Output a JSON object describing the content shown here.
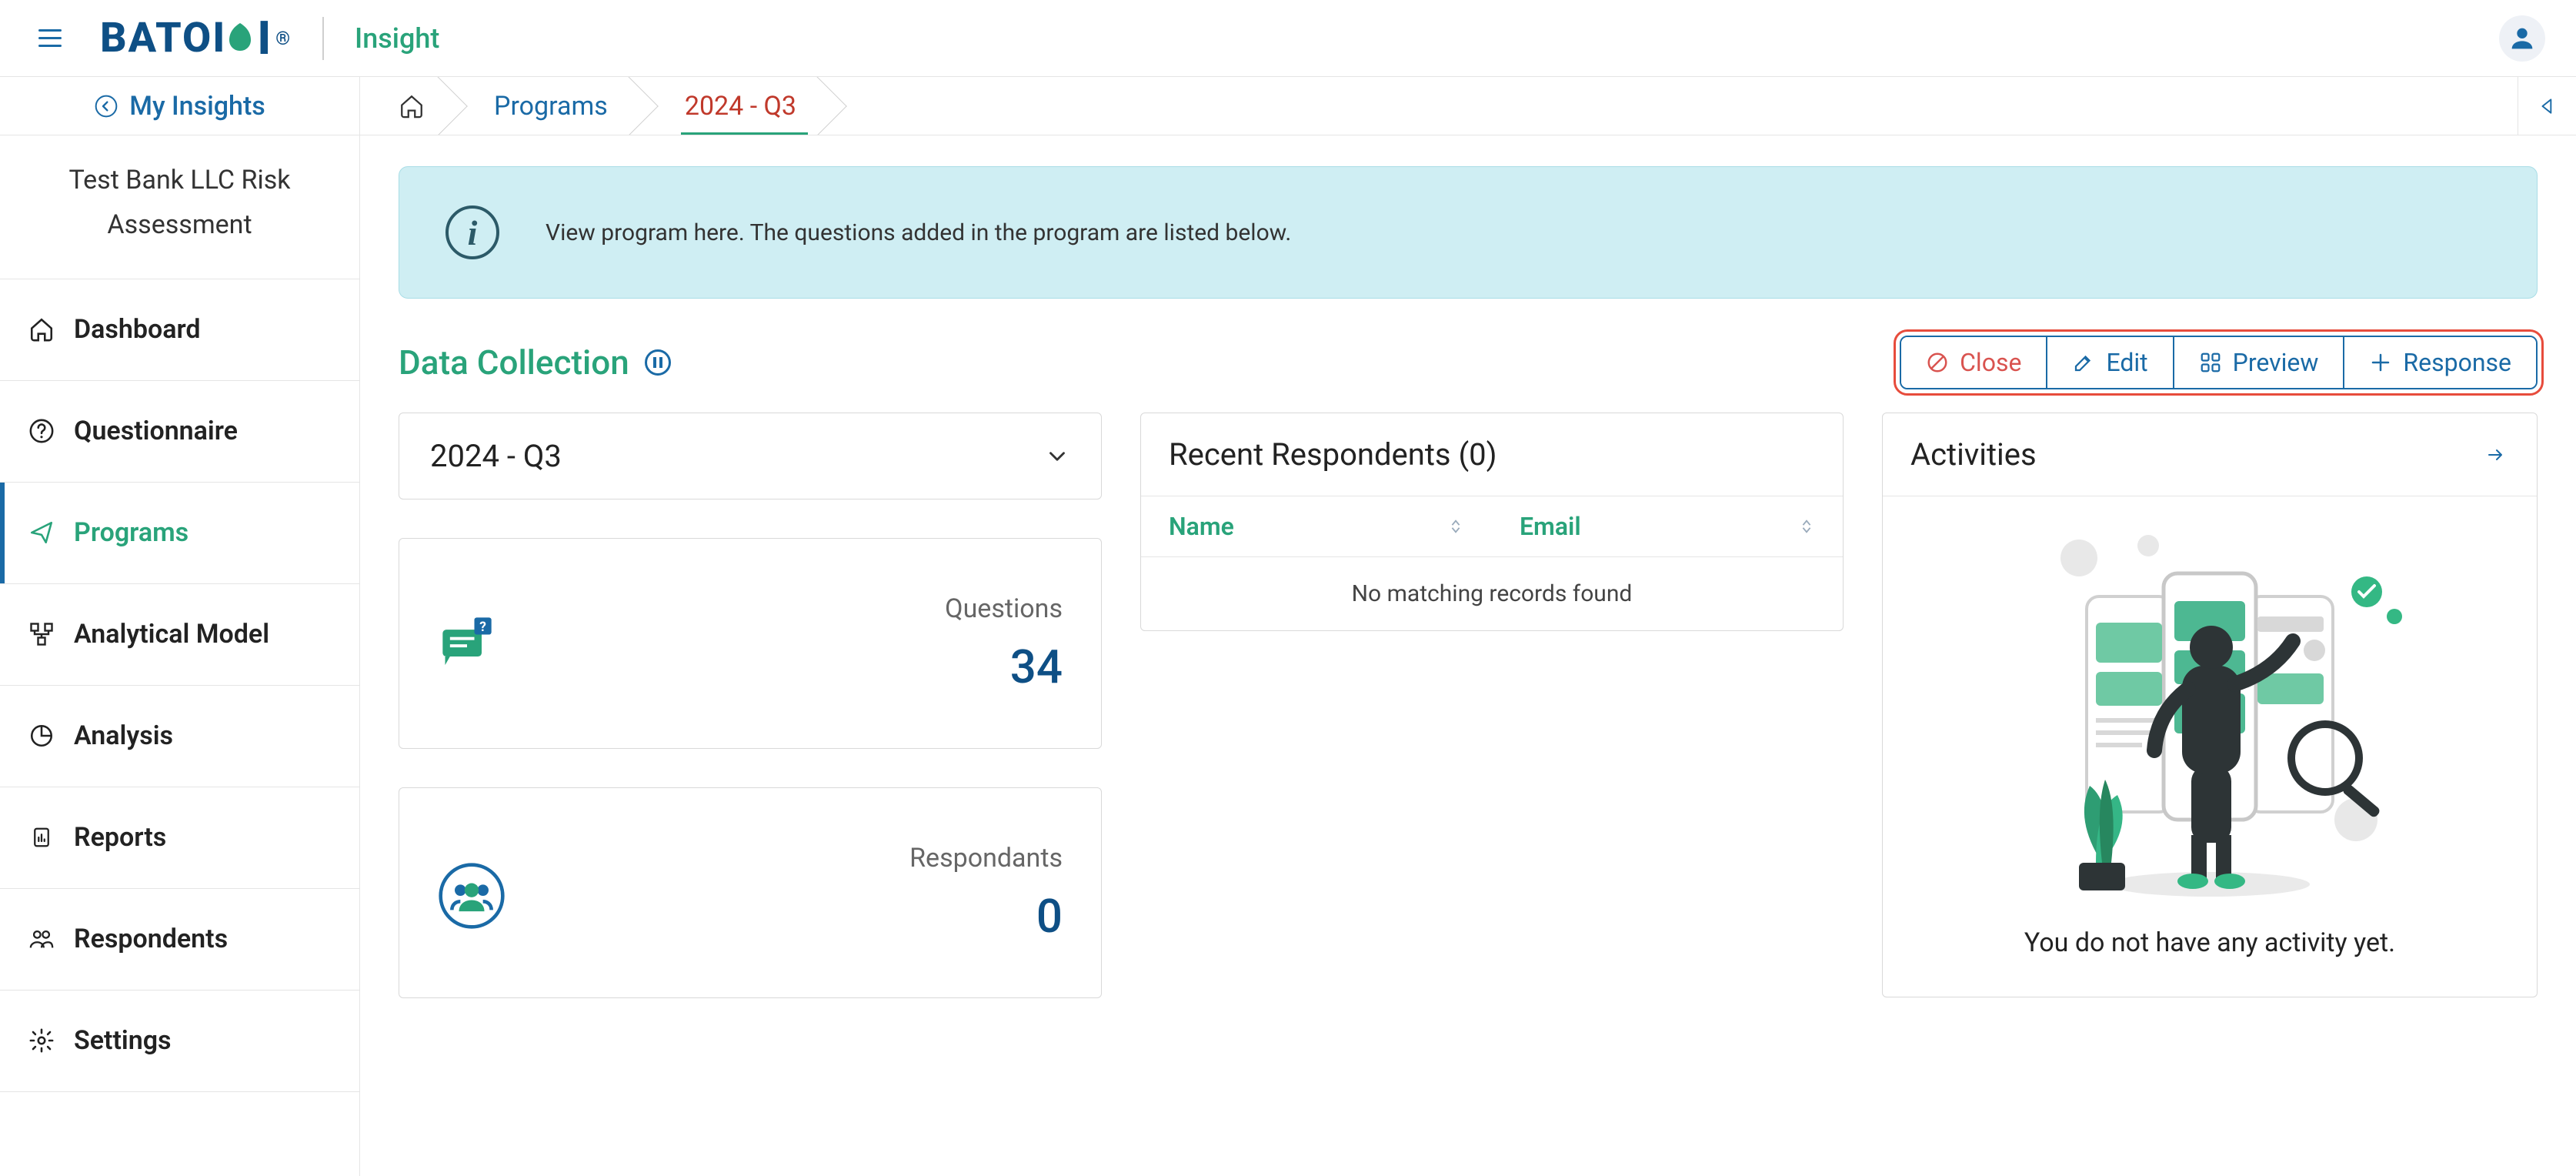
{
  "header": {
    "brand": "BATOI",
    "product": "Insight",
    "my_insights_label": "My Insights"
  },
  "breadcrumb": {
    "programs_label": "Programs",
    "current_label": "2024  -  Q3"
  },
  "sidebar": {
    "title": "Test Bank LLC Risk Assessment",
    "items": [
      {
        "label": "Dashboard",
        "icon": "home-icon"
      },
      {
        "label": "Questionnaire",
        "icon": "question-icon"
      },
      {
        "label": "Programs",
        "icon": "send-icon",
        "active": true
      },
      {
        "label": "Analytical Model",
        "icon": "model-icon"
      },
      {
        "label": "Analysis",
        "icon": "pie-icon"
      },
      {
        "label": "Reports",
        "icon": "report-icon"
      },
      {
        "label": "Respondents",
        "icon": "people-icon"
      },
      {
        "label": "Settings",
        "icon": "gear-icon"
      }
    ]
  },
  "banner": {
    "text": "View program here. The questions added in the program are listed below."
  },
  "section": {
    "title": "Data Collection"
  },
  "actions": {
    "close": "Close",
    "edit": "Edit",
    "preview": "Preview",
    "response": "Response"
  },
  "period": {
    "selected": "2024 - Q3"
  },
  "stats": {
    "questions_label": "Questions",
    "questions_value": "34",
    "respondents_label": "Respondants",
    "respondents_value": "0"
  },
  "respondents": {
    "header": "Recent Respondents (0)",
    "col_name": "Name",
    "col_email": "Email",
    "empty": "No matching records found"
  },
  "activities": {
    "header": "Activities",
    "empty": "You do not have any activity yet."
  }
}
